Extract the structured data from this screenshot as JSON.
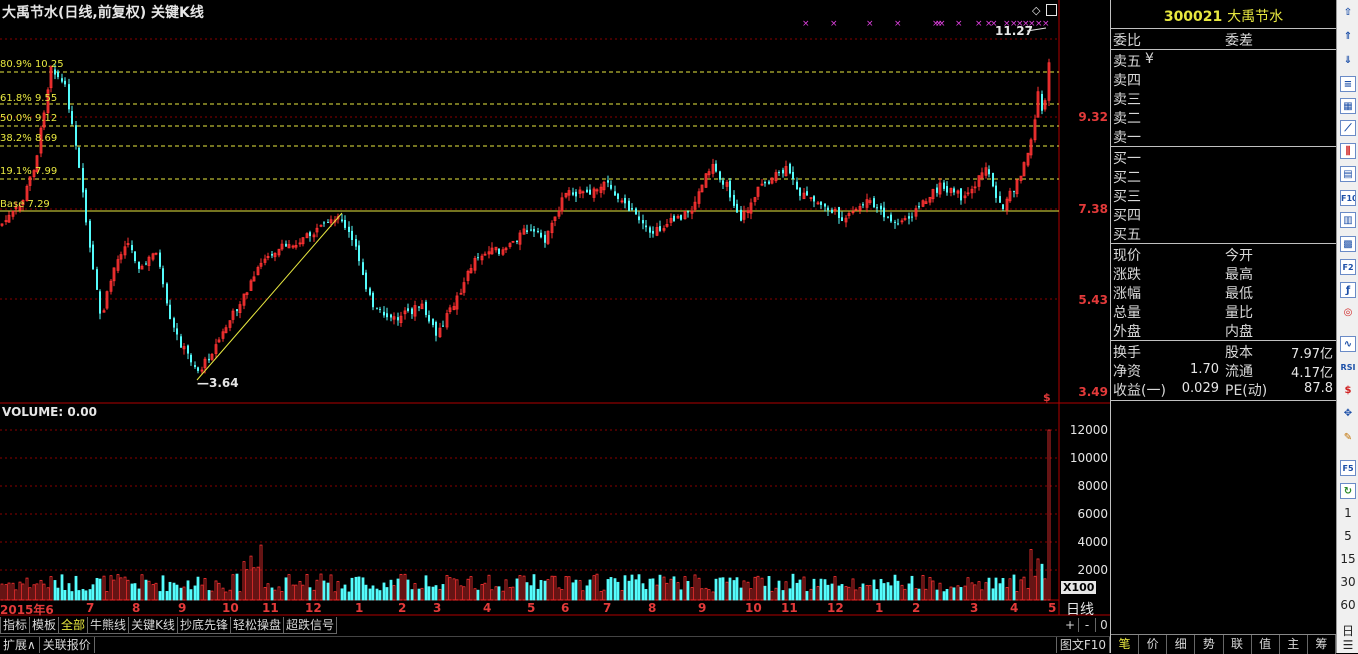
{
  "chart_header": {
    "title": "大禹节水(日线,前复权) 关键K线",
    "volume_title": "VOLUME: 0.00"
  },
  "price_axis": {
    "labels": [
      "9.32",
      "7.38",
      "5.43",
      "3.49"
    ]
  },
  "volume_axis": {
    "labels": [
      "12000",
      "10000",
      "8000",
      "6000",
      "4000",
      "2000"
    ],
    "unit_badge": "X100"
  },
  "fib_levels": [
    {
      "label": "80.9% 10.25"
    },
    {
      "label": "61.8% 9.55"
    },
    {
      "label": "50.0% 9.12"
    },
    {
      "label": "38.2% 8.69"
    },
    {
      "label": "19.1% 7.99"
    },
    {
      "label": "Base 7.29"
    }
  ],
  "annotations": {
    "high": "11.27",
    "low": "3.64"
  },
  "months": [
    "2015年6",
    "7",
    "8",
    "9",
    "10",
    "11",
    "12",
    "1",
    "2",
    "3",
    "4",
    "5",
    "6",
    "7",
    "8",
    "9",
    "10",
    "11",
    "12",
    "1",
    "2",
    "3",
    "4",
    "5"
  ],
  "period_label": "日线",
  "bottom_tabs": [
    "指标",
    "模板",
    "全部",
    "牛熊线",
    "关键K线",
    "抄底先锋",
    "轻松操盘",
    "超跌信号"
  ],
  "zoom_controls": [
    "+",
    "-",
    "0"
  ],
  "bottom_bar": {
    "left": [
      "扩展∧",
      "关联报价"
    ],
    "right": "图文F10"
  },
  "quote_panel": {
    "code": "300021",
    "name": "大禹节水",
    "ratio_label": "委比",
    "diff_label": "委差",
    "sell": [
      "卖五",
      "卖四",
      "卖三",
      "卖二",
      "卖一"
    ],
    "sell_currency": "¥",
    "buy": [
      "买一",
      "买二",
      "买三",
      "买四",
      "买五"
    ],
    "stats_left": [
      "现价",
      "涨跌",
      "涨幅",
      "总量",
      "外盘"
    ],
    "stats_right": [
      "今开",
      "最高",
      "最低",
      "量比",
      "内盘"
    ],
    "fund": [
      {
        "l": "换手",
        "v1": "",
        "m": "股本",
        "v2": "7.97亿"
      },
      {
        "l": "净资",
        "v1": "1.70",
        "m": "流通",
        "v2": "4.17亿"
      },
      {
        "l": "收益(一)",
        "v1": "0.029",
        "m": "PE(动)",
        "v2": "87.8"
      }
    ],
    "tabs": [
      "笔",
      "价",
      "细",
      "势",
      "联",
      "值",
      "主",
      "筹"
    ]
  },
  "toolbar_numbers": [
    "1",
    "5",
    "15",
    "30",
    "60",
    "日"
  ],
  "colors": {
    "up": "#ff3232",
    "down": "#54fcfc",
    "fib": "#e8e840",
    "grid": "#8a0000",
    "axis": "#b00000"
  }
}
